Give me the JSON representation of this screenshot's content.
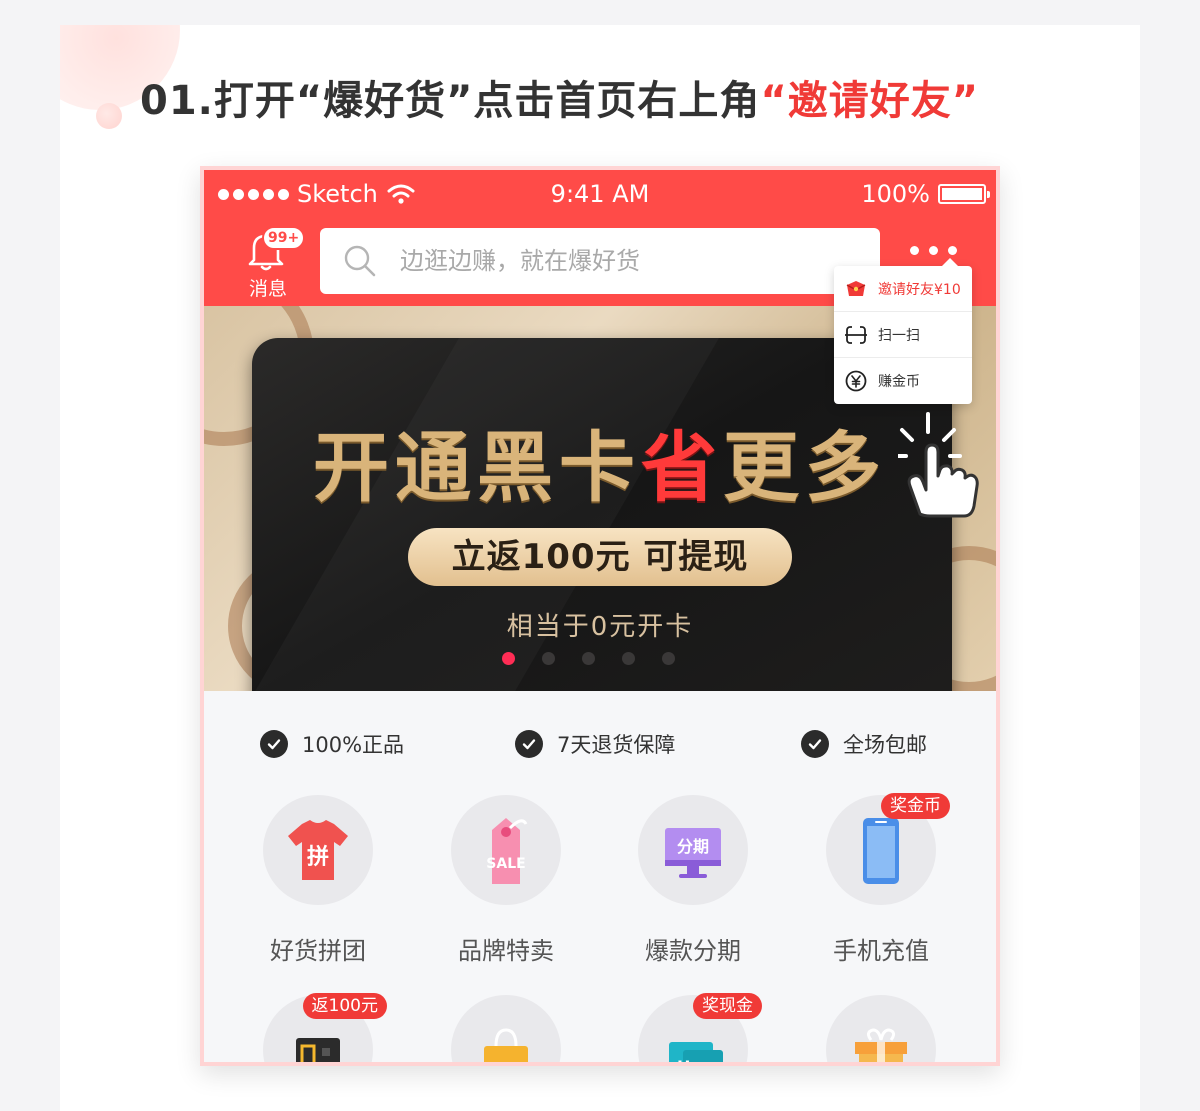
{
  "step": {
    "prefix": "01.打开“爆好货”点击首页右上角",
    "highlight": "“邀请好友”"
  },
  "status_bar": {
    "carrier": "Sketch",
    "time": "9:41 AM",
    "battery": "100%"
  },
  "header": {
    "badge": "99+",
    "messages_label": "消息",
    "search_placeholder": "边逛边赚，就在爆好货"
  },
  "popup_menu": {
    "items": [
      {
        "label": "邀请好友¥10",
        "icon": "red-envelope-icon"
      },
      {
        "label": "扫一扫",
        "icon": "scan-icon"
      },
      {
        "label": "赚金币",
        "icon": "yuan-coin-icon"
      }
    ]
  },
  "banner": {
    "title_a": "开通黑卡",
    "title_red": "省",
    "title_b": "更多",
    "pill": "立返100元 可提现",
    "sub": "相当于0元开卡",
    "page_count": 5,
    "active_page": 1
  },
  "guarantees": [
    "100%正品",
    "7天退货保障",
    "全场包邮"
  ],
  "categories": [
    {
      "label": "好货拼团",
      "icon": "tshirt-icon",
      "tag": ""
    },
    {
      "label": "品牌特卖",
      "icon": "sale-tag-icon",
      "tag": ""
    },
    {
      "label": "爆款分期",
      "icon": "monitor-icon",
      "tag": ""
    },
    {
      "label": "手机充值",
      "icon": "phone-icon",
      "tag": "奖金币"
    }
  ],
  "categories_row2": [
    {
      "icon": "card-icon",
      "tag": "返100元"
    },
    {
      "icon": "shopping-bag-icon",
      "tag": ""
    },
    {
      "icon": "hotel-icon",
      "tag": "奖现金"
    },
    {
      "icon": "gift-icon",
      "tag": ""
    }
  ],
  "colors": {
    "brand_red": "#ff4b48",
    "highlight_red": "#f03a37",
    "gold": "#d9b47a",
    "pager_active": "#ff2d55"
  }
}
